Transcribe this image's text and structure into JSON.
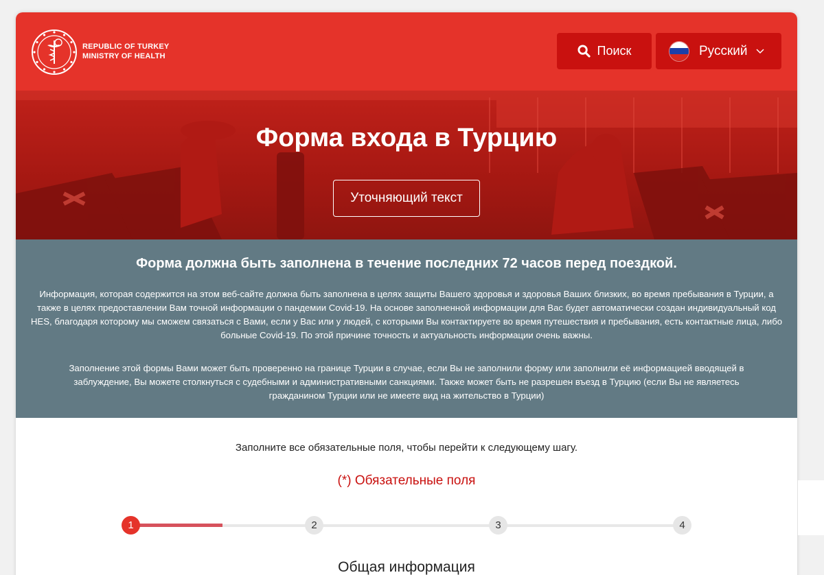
{
  "header": {
    "ministry_line1": "REPUBLIC OF TURKEY",
    "ministry_line2": "MINISTRY OF HEALTH",
    "search_label": "Поиск",
    "language_label": "Русский"
  },
  "hero": {
    "title": "Форма входа в Турцию",
    "button_label": "Уточняющий текст"
  },
  "info": {
    "heading": "Форма должна быть заполнена в течение последних 72 часов перед поездкой.",
    "paragraph1": "Информация, которая содержится на этом веб-сайте должна быть заполнена в целях защиты Вашего здоровья и здоровья Ваших близких, во время пребывания в Турции, а также в целях предоставлении Вам точной информации о пандемии Covid-19. На основе заполненной информации для Вас будет автоматически создан индивидуальный код HES, благодаря которому мы сможем связаться с Вами, если у Вас или у людей, с которыми Вы контактируете во время путешествия и пребывания, есть контактные лица, либо больные Covid-19. По этой причине точность и актуальность информации очень важны.",
    "paragraph2": "Заполнение этой формы Вами может быть проверенно на границе Турции в случае, если Вы не заполнили форму или заполнили её информацией вводящей в заблуждение, Вы можете столкнуться с судебными и административными санкциями. Также может быть не разрешен въезд в Турцию (если Вы не являетесь гражданином Турции или не имеете вид на жительство в Турции)"
  },
  "form": {
    "intro": "Заполните все обязательные поля, чтобы перейти к следующему шагу.",
    "required_note": "(*) Обязательные поля",
    "steps": [
      "1",
      "2",
      "3",
      "4"
    ],
    "progress_fraction": 0.165,
    "section_title": "Общая информация"
  },
  "colors": {
    "brand_red": "#e5332a",
    "button_red": "#c9110f",
    "info_panel": "#627a84"
  },
  "icons": {
    "search": "search-icon",
    "chevron": "chevron-down-icon",
    "flag": "russia-flag-icon",
    "logo": "ministry-emblem-icon"
  }
}
